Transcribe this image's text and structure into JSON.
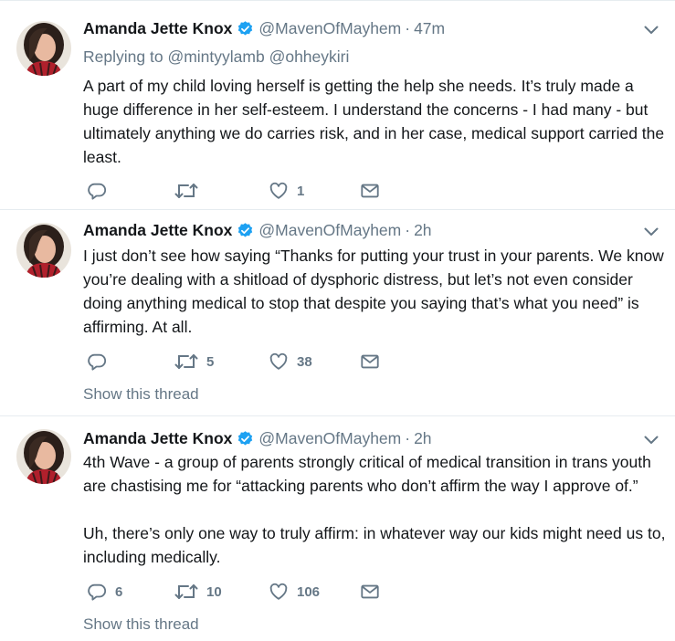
{
  "colors": {
    "text": "#14171a",
    "muted": "#657786",
    "verified": "#1da1f2",
    "divider": "#e6ecf0"
  },
  "tweets": [
    {
      "author_name": "Amanda Jette Knox",
      "handle": "@MavenOfMayhem",
      "separator": "·",
      "time": "47m",
      "replying_prefix": "Replying to",
      "replying_to": [
        "@mintyylamb",
        "@ohheykiri"
      ],
      "text": [
        "A part of my child loving herself is getting the help she needs. It’s truly made a huge difference in her self-esteem. I understand the concerns - I had many - but ultimately anything we do carries risk, and in her case, medical support carried the least."
      ],
      "replies": "",
      "retweets": "",
      "likes": "1",
      "show_thread": ""
    },
    {
      "author_name": "Amanda Jette Knox",
      "handle": "@MavenOfMayhem",
      "separator": "·",
      "time": "2h",
      "text": [
        "I just don’t see how saying “Thanks for putting your trust in your parents. We know you’re dealing with a shitload of dysphoric distress, but let’s not even consider doing anything medical to stop that despite you saying that’s what you need” is affirming. At all."
      ],
      "replies": "",
      "retweets": "5",
      "likes": "38",
      "show_thread": "Show this thread"
    },
    {
      "author_name": "Amanda Jette Knox",
      "handle": "@MavenOfMayhem",
      "separator": "·",
      "time": "2h",
      "text": [
        "4th Wave - a group of parents strongly critical of medical transition in trans youth are chastising me for “attacking parents who don’t affirm the way I approve of.”",
        "Uh, there’s only one way to truly affirm: in whatever way our kids might need us to, including medically."
      ],
      "replies": "6",
      "retweets": "10",
      "likes": "106",
      "show_thread": "Show this thread"
    }
  ],
  "icons": {
    "verified": "verified-badge-icon",
    "caret": "chevron-down-icon",
    "reply": "reply-icon",
    "retweet": "retweet-icon",
    "like": "heart-icon",
    "message": "envelope-icon"
  }
}
